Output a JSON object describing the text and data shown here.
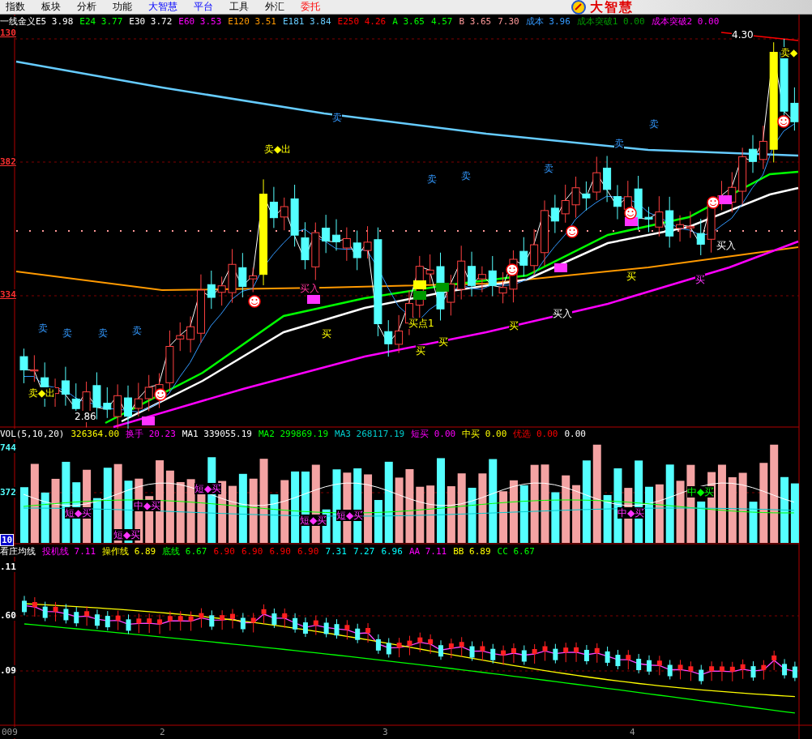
{
  "menu": [
    "指数",
    "板块",
    "分析",
    "功能",
    "大智慧",
    "平台",
    "工具",
    "外汇",
    "委托"
  ],
  "logo": {
    "text": "大智慧"
  },
  "main_panel": {
    "axis_labels": [
      "130",
      "382",
      "334"
    ],
    "legend": [
      "一线金义E5 3.98",
      "E24 3.77",
      "E30 3.72",
      "E60 3.53",
      "E120 3.51",
      "E181 3.84",
      "E250 4.26",
      "A 3.65",
      "4.57",
      "B 3.65",
      "7.30",
      "成本 3.96",
      "成本突破1 0.00",
      "成本突破2 0.00"
    ],
    "annotations": [
      {
        "text": "卖◆出",
        "kind": "exit"
      },
      {
        "text": "卖◆出",
        "kind": "exit"
      },
      {
        "text": "卖◆",
        "kind": "exit"
      },
      {
        "text": "卖",
        "kind": "sell"
      },
      {
        "text": "卖",
        "kind": "sell"
      },
      {
        "text": "卖",
        "kind": "sell"
      },
      {
        "text": "卖",
        "kind": "sell"
      },
      {
        "text": "卖",
        "kind": "sell"
      },
      {
        "text": "卖",
        "kind": "sell"
      },
      {
        "text": "卖",
        "kind": "sell"
      },
      {
        "text": "卖",
        "kind": "sell"
      },
      {
        "text": "卖",
        "kind": "sell"
      },
      {
        "text": "卖",
        "kind": "sell"
      },
      {
        "text": "买入",
        "kind": "alert"
      },
      {
        "text": "买",
        "kind": "buy"
      },
      {
        "text": "买点1",
        "kind": "buy"
      },
      {
        "text": "买",
        "kind": "buy"
      },
      {
        "text": "买",
        "kind": "buy"
      },
      {
        "text": "买",
        "kind": "buy"
      },
      {
        "text": "买入",
        "kind": "entry"
      },
      {
        "text": "买",
        "kind": "buy"
      },
      {
        "text": "买",
        "kind": "trend"
      },
      {
        "text": "买入",
        "kind": "entry"
      },
      {
        "text": "4.30",
        "kind": "price"
      },
      {
        "text": "2.86",
        "kind": "price"
      }
    ]
  },
  "volume_panel": {
    "axis_labels": [
      "744",
      "372",
      "10"
    ],
    "legend": [
      "VOL(5,10,20)",
      "326364.00",
      "换手 20.23",
      "MA1 339055.19",
      "MA2 299869.19",
      "MA3 268117.19",
      "短买 0.00",
      "中买 0.00",
      "优选 0.00",
      "0.00"
    ],
    "annotations": [
      {
        "text": "短◆买",
        "kind": "short"
      },
      {
        "text": "中◆买",
        "kind": "short"
      },
      {
        "text": "短◆买",
        "kind": "short"
      },
      {
        "text": "短◆买",
        "kind": "short"
      },
      {
        "text": "短◆买",
        "kind": "short"
      },
      {
        "text": "短◆买",
        "kind": "short"
      },
      {
        "text": "中◆买",
        "kind": "short"
      },
      {
        "text": "中◆买",
        "kind": "mid"
      }
    ]
  },
  "indicator_panel": {
    "axis_labels": [
      ".11",
      ".60",
      ".09"
    ],
    "legend": [
      "看庄均线",
      "投机线 7.11",
      "操作线 6.89",
      "底线 6.67",
      "6.90",
      "6.90",
      "6.90",
      "6.90",
      "7.31",
      "7.27",
      "6.96",
      "AA 7.11",
      "BB 6.89",
      "CC 6.67"
    ]
  },
  "x_axis": {
    "labels": [
      "009",
      "2",
      "3",
      "4"
    ]
  }
}
